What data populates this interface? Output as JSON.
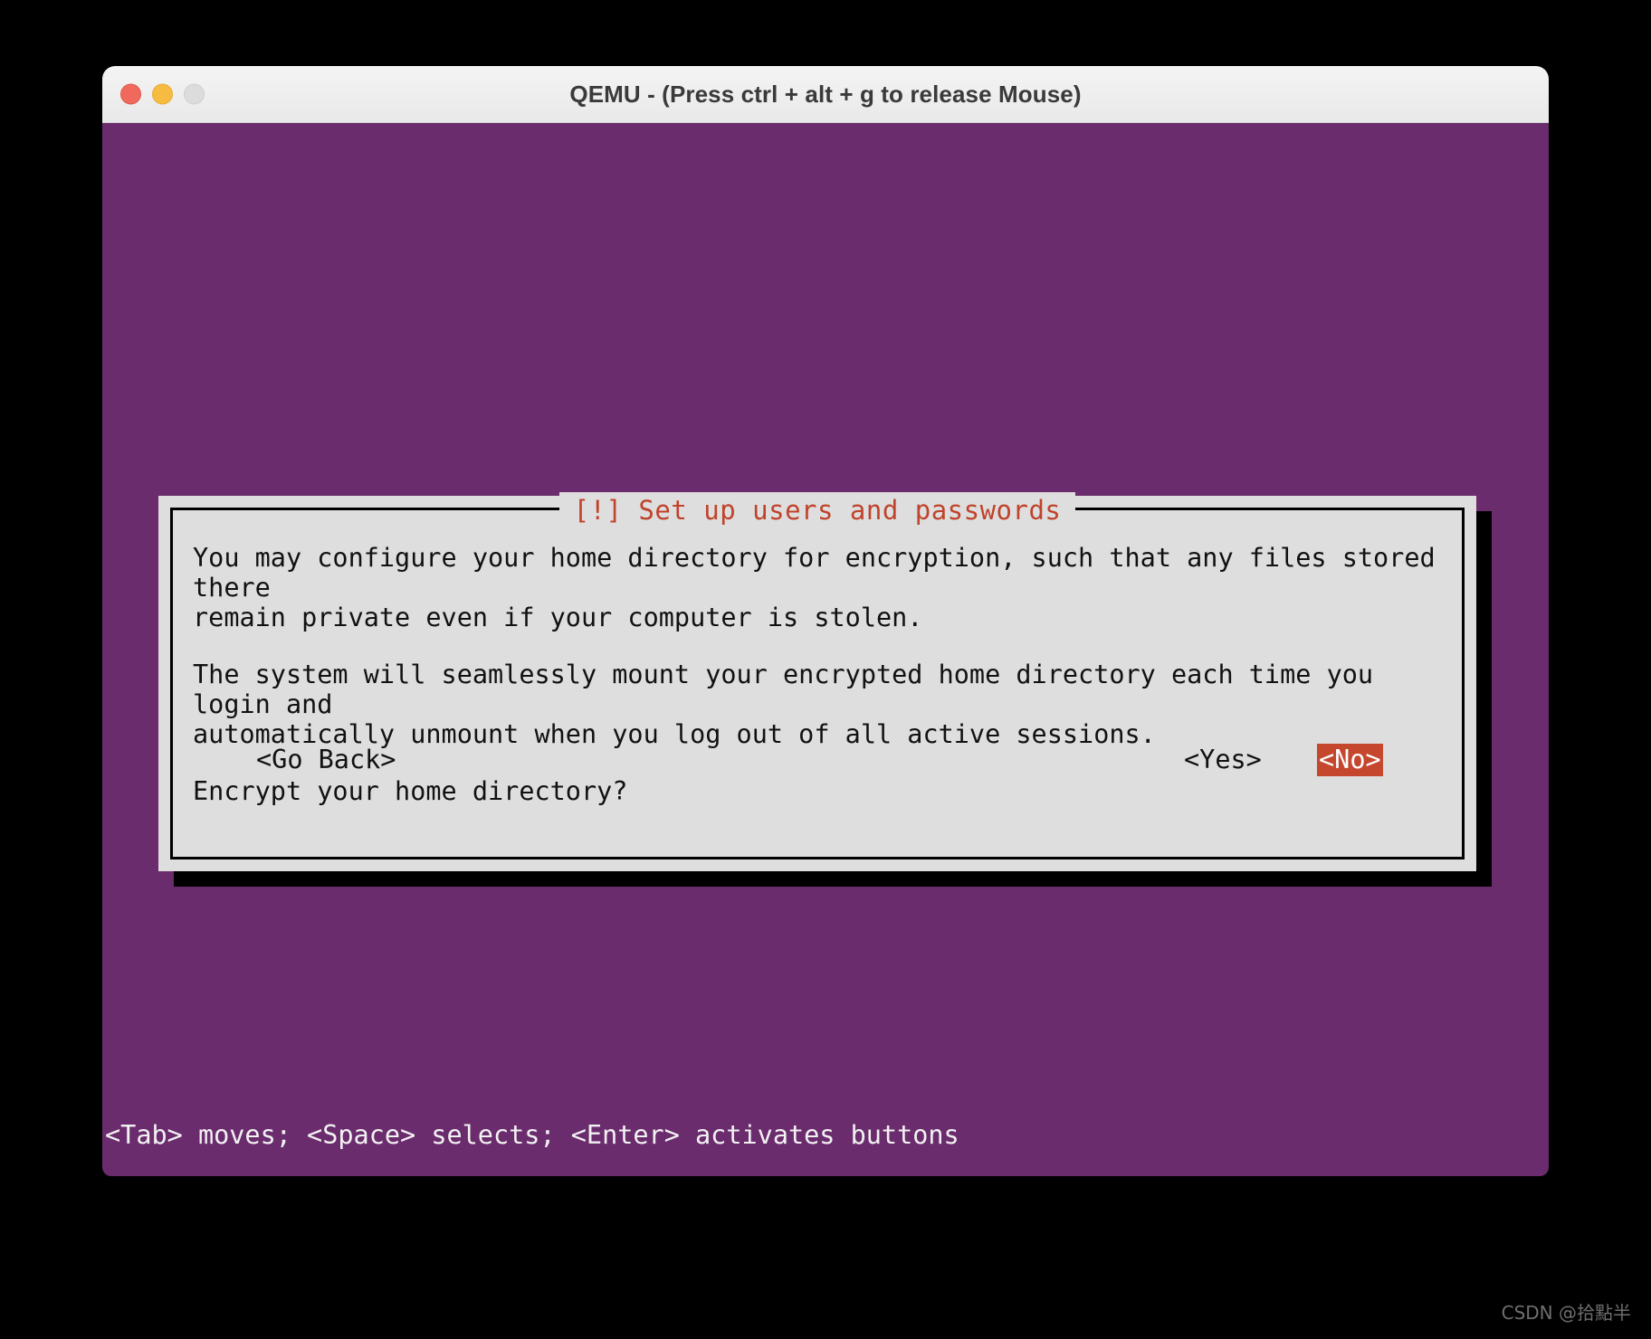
{
  "window": {
    "title": "QEMU - (Press ctrl + alt + g to release Mouse)",
    "controls": {
      "close": "close-button",
      "minimize": "minimize-button",
      "zoom": "zoom-button"
    },
    "background_color": "#6B2C6E"
  },
  "dialog": {
    "title": "[!] Set up users and passwords",
    "title_color": "#c0432b",
    "background_color": "#dedede",
    "paragraphs": [
      "You may configure your home directory for encryption, such that any files stored there\nremain private even if your computer is stolen.",
      "The system will seamlessly mount your encrypted home directory each time you login and\nautomatically unmount when you log out of all active sessions.",
      "Encrypt your home directory?"
    ],
    "buttons": [
      {
        "label": "<Go Back>",
        "selected": false
      },
      {
        "label": "<Yes>",
        "selected": false
      },
      {
        "label": "<No>",
        "selected": true,
        "selected_bg": "#c5472e",
        "selected_fg": "#ffffff"
      }
    ]
  },
  "help_line": "<Tab> moves; <Space> selects; <Enter> activates buttons",
  "watermark": "CSDN @拾點半"
}
